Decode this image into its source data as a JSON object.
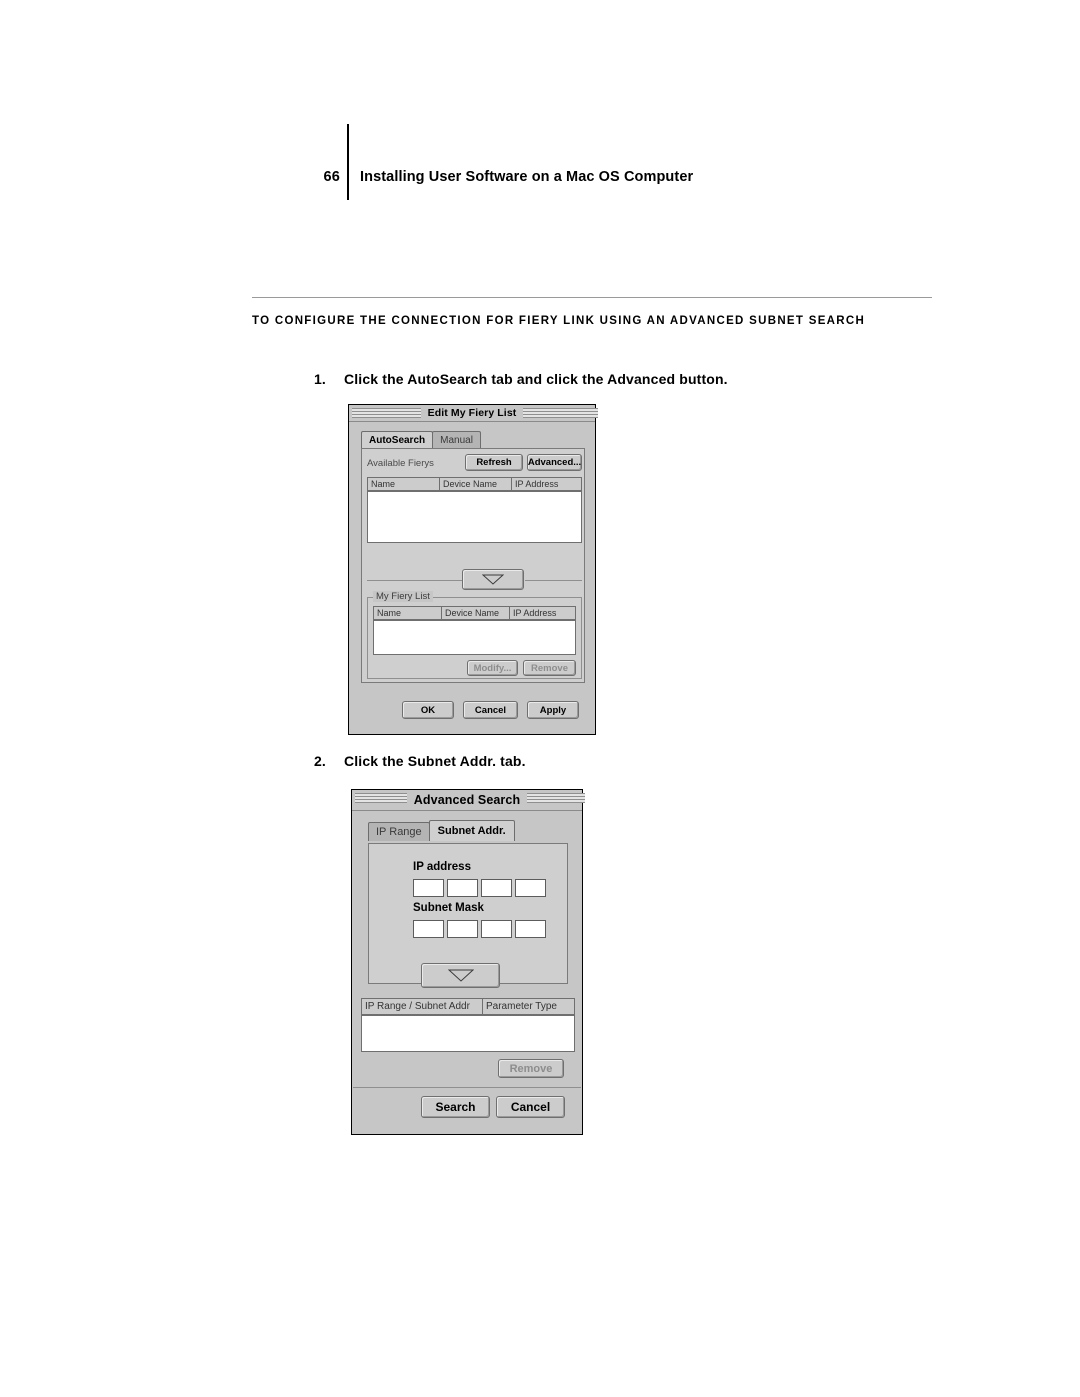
{
  "page": {
    "number": "66",
    "header_title": "Installing User Software on a Mac OS Computer",
    "procedure_heading_line1_big1": "T",
    "procedure_heading_line1": "O CONFIGURE THE CONNECTION FOR ",
    "procedure_heading": "TO CONFIGURE THE CONNECTION FOR FIERY LINK USING AN ADVANCED SUBNET SEARCH"
  },
  "steps": [
    {
      "num": "1.",
      "text": "Click the AutoSearch tab and click the Advanced button."
    },
    {
      "num": "2.",
      "text": "Click the Subnet Addr. tab."
    }
  ],
  "dialog1": {
    "title": "Edit My Fiery List",
    "tabs": [
      {
        "label": "AutoSearch",
        "active": true
      },
      {
        "label": "Manual",
        "active": false
      }
    ],
    "available_label": "Available Fierys",
    "buttons": {
      "refresh": "Refresh",
      "advanced": "Advanced...",
      "modify": "Modify...",
      "remove": "Remove",
      "ok": "OK",
      "cancel": "Cancel",
      "apply": "Apply"
    },
    "available_columns": [
      "Name",
      "Device Name",
      "IP Address"
    ],
    "my_fiery_group_label": "My Fiery List",
    "my_fiery_columns": [
      "Name",
      "Device Name",
      "IP Address"
    ],
    "move_down_icon": "triangle-down-icon"
  },
  "dialog2": {
    "title": "Advanced Search",
    "tabs": [
      {
        "label": "IP Range",
        "active": false
      },
      {
        "label": "Subnet Addr.",
        "active": true
      }
    ],
    "ip_address_label": "IP address",
    "subnet_mask_label": "Subnet Mask",
    "ip_address_fields": [
      "",
      "",
      "",
      ""
    ],
    "subnet_mask_fields": [
      "",
      "",
      "",
      ""
    ],
    "move_down_icon": "triangle-down-icon",
    "result_columns": [
      "IP Range / Subnet Addr",
      "Parameter Type"
    ],
    "buttons": {
      "remove": "Remove",
      "search": "Search",
      "cancel": "Cancel"
    }
  }
}
